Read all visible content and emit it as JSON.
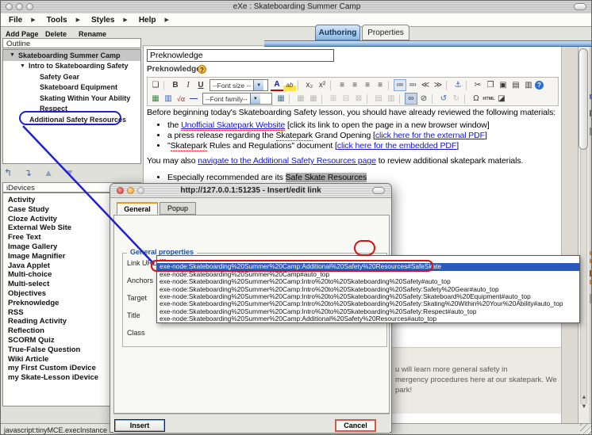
{
  "window": {
    "title": "eXe : Skateboarding Summer Camp"
  },
  "menu": {
    "items": [
      "File",
      "Tools",
      "Styles",
      "Help"
    ]
  },
  "page_toolbar": {
    "add_page": "Add Page",
    "delete_label": "Delete",
    "rename": "Rename"
  },
  "view_tabs": {
    "authoring": "Authoring",
    "properties": "Properties"
  },
  "outline": {
    "header": "Outline",
    "items": [
      {
        "label": "Skateboarding Summer Camp"
      },
      {
        "label": "Intro to Skateboarding Safety"
      },
      {
        "label": "Safety Gear"
      },
      {
        "label": "Skateboard Equipment"
      },
      {
        "label": "Skating Within Your Ability"
      },
      {
        "label": "Respect"
      },
      {
        "label": "Additional Safety Resources"
      }
    ]
  },
  "idevices": {
    "header": "iDevices",
    "items": [
      "Activity",
      "Case Study",
      "Cloze Activity",
      "External Web Site",
      "Free Text",
      "Image Gallery",
      "Image Magnifier",
      "Java Applet",
      "Multi-choice",
      "Multi-select",
      "Objectives",
      "Preknowledge",
      "RSS",
      "Reading Activity",
      "Reflection",
      "SCORM Quiz",
      "True-False Question",
      "Wiki Article",
      "my First Custom iDevice",
      "my Skate-Lesson iDevice"
    ]
  },
  "status": {
    "text": "javascript:tinyMCE.execInstance"
  },
  "editor": {
    "title_value": "Preknowledge",
    "idevice_label": "Preknowledge",
    "font_size_label": "--Font size --",
    "font_family_label": "--Font family--",
    "toolbar_row1a": [
      {
        "n": "new-document-icon",
        "g": "❏"
      },
      {
        "n": "separator",
        "c": "sep"
      },
      {
        "n": "bold-icon",
        "g": "B",
        "c": "bold"
      },
      {
        "n": "italic-icon",
        "g": "I",
        "c": "italic"
      },
      {
        "n": "underline-icon",
        "g": "U",
        "c": "und"
      }
    ],
    "toolbar_row1b": [
      {
        "n": "font-color-icon",
        "g": "A",
        "c": "fcolor"
      },
      {
        "n": "highlight-icon",
        "g": "ab",
        "c": "hl"
      },
      {
        "n": "separator",
        "c": "sep"
      },
      {
        "n": "subscript-icon",
        "g": "x₂"
      },
      {
        "n": "superscript-icon",
        "g": "x²"
      },
      {
        "n": "separator",
        "c": "sep"
      },
      {
        "n": "align-left-icon",
        "g": "≡"
      },
      {
        "n": "align-center-icon",
        "g": "≡"
      },
      {
        "n": "align-right-icon",
        "g": "≡"
      },
      {
        "n": "align-justify-icon",
        "g": "≡"
      },
      {
        "n": "separator",
        "c": "sep"
      },
      {
        "n": "bullet-list-icon",
        "g": "≔",
        "c": "boxed"
      },
      {
        "n": "numbered-list-icon",
        "g": "≕"
      },
      {
        "n": "outdent-icon",
        "g": "≪"
      },
      {
        "n": "indent-icon",
        "g": "≫"
      },
      {
        "n": "separator",
        "c": "sep"
      },
      {
        "n": "anchor-icon",
        "g": "⚓",
        "c": "blue"
      },
      {
        "n": "separator",
        "c": "sep"
      },
      {
        "n": "cut-icon",
        "g": "✂"
      },
      {
        "n": "copy-icon",
        "g": "❐"
      },
      {
        "n": "paste-icon",
        "g": "▣"
      },
      {
        "n": "paste-text-icon",
        "g": "▤"
      },
      {
        "n": "paste-word-icon",
        "g": "▥"
      },
      {
        "n": "help-icon",
        "g": "?",
        "c": "helpc"
      }
    ],
    "toolbar_row2a": [
      {
        "n": "insert-image-icon",
        "g": "▦",
        "c": "green"
      },
      {
        "n": "insert-media-icon",
        "g": "▥",
        "c": "blue"
      },
      {
        "n": "formula-icon",
        "g": "√α",
        "c": "formula"
      },
      {
        "n": "horizontal-rule-icon",
        "g": "—",
        "c": "rule"
      }
    ],
    "toolbar_row2b": [
      {
        "n": "table-edit-icon",
        "g": "▦",
        "c": "tbl"
      },
      {
        "n": "separator",
        "c": "sep"
      },
      {
        "n": "table-row-props-icon",
        "g": "▦",
        "c": "grey"
      },
      {
        "n": "table-cell-props-icon",
        "g": "▦",
        "c": "grey"
      },
      {
        "n": "separator",
        "c": "sep"
      },
      {
        "n": "insert-row-icon",
        "g": "⊞",
        "c": "grey"
      },
      {
        "n": "delete-row-icon",
        "g": "⊟",
        "c": "grey"
      },
      {
        "n": "delete-col-icon",
        "g": "⊠",
        "c": "grey"
      },
      {
        "n": "separator",
        "c": "sep"
      },
      {
        "n": "split-cells-icon",
        "g": "▤",
        "c": "grey"
      },
      {
        "n": "merge-cells-icon",
        "g": "▥",
        "c": "grey"
      },
      {
        "n": "separator",
        "c": "sep"
      },
      {
        "n": "insert-link-icon",
        "g": "∞",
        "c": "pressed"
      },
      {
        "n": "unlink-icon",
        "g": "⊘"
      },
      {
        "n": "separator",
        "c": "sep"
      },
      {
        "n": "undo-icon",
        "g": "↺",
        "c": "blue"
      },
      {
        "n": "redo-icon",
        "g": "↻",
        "c": "grey"
      },
      {
        "n": "separator",
        "c": "sep"
      },
      {
        "n": "omega-icon",
        "g": "Ω"
      },
      {
        "n": "html-source-icon",
        "g": "HTML",
        "c": "htmlb"
      },
      {
        "n": "cleanup-icon",
        "g": "◪"
      }
    ],
    "content": {
      "p1": "Before beginning today's Skateboarding Safety lesson, you should have already reviewed the following materials:",
      "b1_pre": "the ",
      "b1_link": "Unofficial Skatepark Website",
      "b1_post": " [click its link to open the page in a new browser window]",
      "b2_pre": "a press release regarding the ",
      "b2_sp": "Skatepark",
      "b2_mid": " Grand Opening [",
      "b2_link": "click here for the external PDF",
      "b2_post": "]",
      "b3_pre": "\"",
      "b3_sp": "Skatepark",
      "b3_mid": " Rules and Regulations\" document [",
      "b3_link": "click here for the embedded PDF",
      "b3_post": "]",
      "p2_pre": "You may also ",
      "p2_link": "navigate to the Additional Safety Resources page",
      "p2_post": " to review additional skatepark materials.",
      "b4_pre": "Especially recommended are its ",
      "b4_selected": "Safe Skate Resources"
    }
  },
  "background_box": {
    "lines": [
      "u will learn more general safety in",
      "mergency procedures here at our skatepark. We",
      "park!"
    ]
  },
  "dialog": {
    "title": "http://127.0.0.1:51235 - Insert/edit link",
    "tabs": {
      "general": "General",
      "popup": "Popup"
    },
    "fieldset_legend": "General properties",
    "fields": {
      "link_url": "Link URL",
      "anchors": "Anchors",
      "target": "Target",
      "title_label": "Title",
      "class_label": "Class"
    },
    "anchors_value": "---",
    "buttons": {
      "insert": "Insert",
      "cancel": "Cancel"
    },
    "anchor_options": [
      {
        "t": "---"
      },
      {
        "t": "exe-node:Skateboarding%20Summer%20Camp:Additional%20Safety%20Resources#SafeSkate",
        "selected": true
      },
      {
        "t": "exe-node:Skateboarding%20Summer%20Camp#auto_top"
      },
      {
        "t": "exe-node:Skateboarding%20Summer%20Camp:Intro%20to%20Skateboarding%20Safety#auto_top"
      },
      {
        "t": "exe-node:Skateboarding%20Summer%20Camp:Intro%20to%20Skateboarding%20Safety:Safety%20Gear#auto_top"
      },
      {
        "t": "exe-node:Skateboarding%20Summer%20Camp:Intro%20to%20Skateboarding%20Safety:Skateboard%20Equipment#auto_top"
      },
      {
        "t": "exe-node:Skateboarding%20Summer%20Camp:Intro%20to%20Skateboarding%20Safety:Skating%20Within%20Your%20Ability#auto_top"
      },
      {
        "t": "exe-node:Skateboarding%20Summer%20Camp:Intro%20to%20Skateboarding%20Safety:Respect#auto_top"
      },
      {
        "t": "exe-node:Skateboarding%20Summer%20Camp:Additional%20Safety%20Resources#auto_top"
      }
    ]
  },
  "icons": {
    "menu_arrow": "▶",
    "tree_expand": "▼",
    "combo_arrow": "▼",
    "scroll_up": "▲",
    "scroll_down": "▼",
    "promote": "↰",
    "demote": "↴",
    "move_up": "▲",
    "move_down": "▼",
    "help": "?"
  },
  "colors": {
    "annotation_blue": "#2020cf",
    "annotation_red": "#d11414",
    "link_blue": "#1414cc",
    "selection_grey": "#b0b0b0",
    "tab_active_blue": "#8cb8e8",
    "dialog_tab_accent_orange": "#e8962e",
    "dropdown_selected_blue": "#2a5abe"
  }
}
